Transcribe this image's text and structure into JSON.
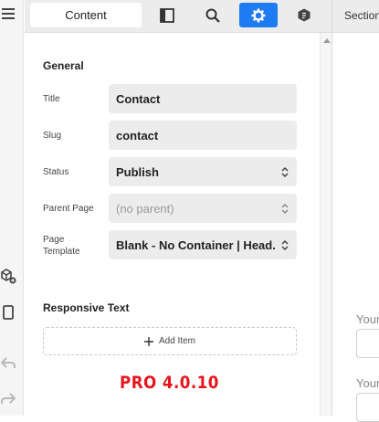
{
  "toolbar": {
    "content_tab": "Content",
    "layout_icon": "layout-panel-icon",
    "search_icon": "search-icon",
    "settings_icon": "gear-icon",
    "plugin_icon": "hexagon-icon"
  },
  "canvas": {
    "top_label": "Section",
    "label_1": "Your",
    "label_2": "Your"
  },
  "general": {
    "heading": "General",
    "title_label": "Title",
    "title_value": "Contact",
    "slug_label": "Slug",
    "slug_value": "contact",
    "status_label": "Status",
    "status_value": "Publish",
    "parent_label": "Parent Page",
    "parent_value": "(no parent)",
    "template_label": "Page Template",
    "template_value": "Blank - No Container | Head..."
  },
  "responsive": {
    "heading": "Responsive Text",
    "add_item_label": "Add Item"
  },
  "badge": {
    "text": "PRO 4.0.10",
    "color": "#e8141c"
  },
  "accent_color": "#1e7bf2"
}
